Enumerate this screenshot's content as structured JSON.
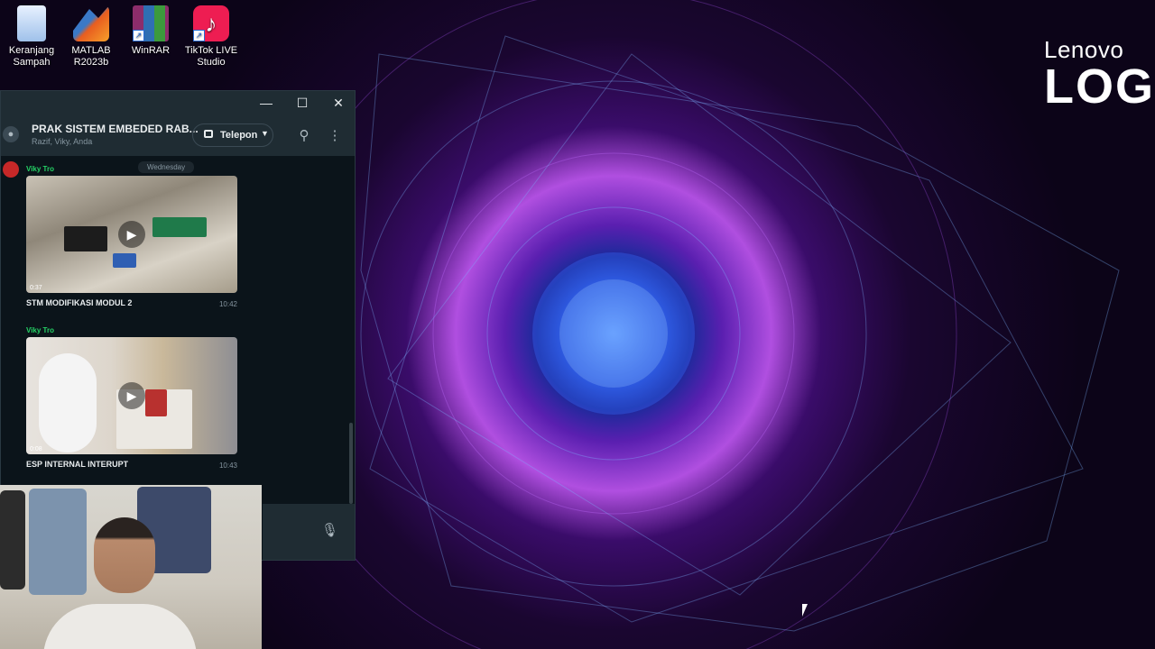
{
  "desktop": {
    "icons": [
      {
        "label": "Keranjang Sampah",
        "icon": "recycle-bin-icon"
      },
      {
        "label": "MATLAB R2023b",
        "icon": "matlab-icon"
      },
      {
        "label": "WinRAR",
        "icon": "winrar-icon"
      },
      {
        "label": "TikTok LIVE Studio",
        "icon": "tiktok-icon"
      }
    ],
    "wallpaper_brand": {
      "line1": "Lenovo",
      "line2": "LOG"
    }
  },
  "whatsapp": {
    "window_controls": {
      "minimize": "—",
      "maximize": "☐",
      "close": "✕"
    },
    "chat": {
      "title": "PRAK SISTEM EMBEDED RAB...",
      "subtitle": "Razif, Viky, Anda",
      "call_label": "Telepon"
    },
    "date_chip": "Wednesday",
    "messages": [
      {
        "sender": "Viky Tro",
        "duration": "0:37",
        "caption": "STM MODIFIKASI MODUL 2",
        "time": "10:42"
      },
      {
        "sender": "Viky Tro",
        "duration": "0:08",
        "caption": "ESP INTERNAL INTERUPT",
        "time": "10:43"
      }
    ]
  },
  "colors": {
    "wa_bg": "#0b141a",
    "wa_header": "#1f2c33",
    "sender_green": "#25d366",
    "tiktok": "#ee1d52"
  }
}
